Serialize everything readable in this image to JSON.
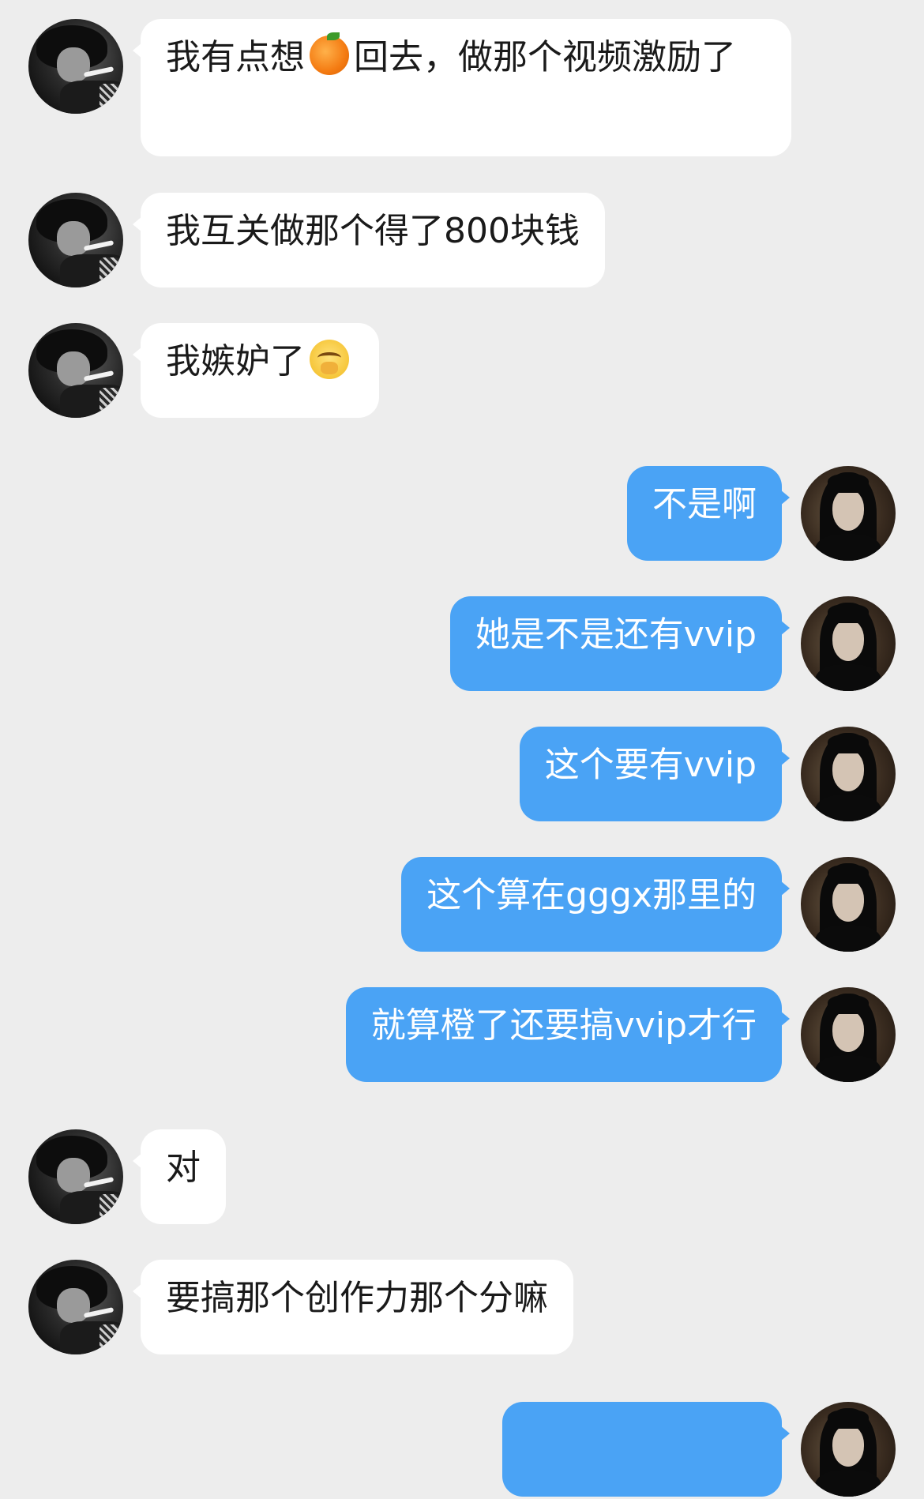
{
  "messages": [
    {
      "side": "left",
      "text_before": "我有点想",
      "emoji": "orange-emoji",
      "text_after": "回去，做那个视频激励了"
    },
    {
      "side": "left",
      "text": "我互关做那个得了800块钱"
    },
    {
      "side": "left",
      "text_before": "我嫉妒了",
      "emoji": "crying-covering-mouth-emoji"
    },
    {
      "side": "right",
      "text": "不是啊"
    },
    {
      "side": "right",
      "text": "她是不是还有vvip"
    },
    {
      "side": "right",
      "text": "这个要有vvip"
    },
    {
      "side": "right",
      "text": "这个算在gggx那里的"
    },
    {
      "side": "right",
      "text": "就算橙了还要搞vvip才行"
    },
    {
      "side": "left",
      "text": "对"
    },
    {
      "side": "left",
      "text": "要搞那个创作力那个分嘛"
    },
    {
      "side": "right",
      "text": ""
    }
  ],
  "colors": {
    "background": "#ededed",
    "incoming_bubble": "#ffffff",
    "outgoing_bubble": "#4aa3f5",
    "incoming_text": "#1a1a1a",
    "outgoing_text": "#ffffff"
  }
}
